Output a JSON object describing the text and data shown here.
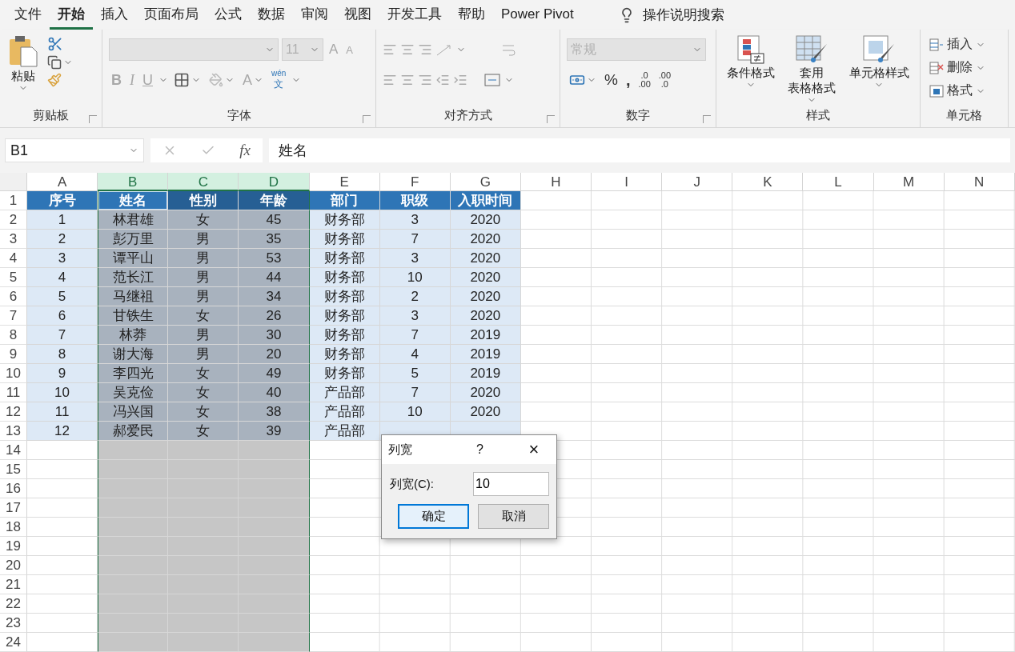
{
  "menu_tabs": [
    {
      "label": "文件",
      "selected": false
    },
    {
      "label": "开始",
      "selected": true
    },
    {
      "label": "插入",
      "selected": false
    },
    {
      "label": "页面布局",
      "selected": false
    },
    {
      "label": "公式",
      "selected": false
    },
    {
      "label": "数据",
      "selected": false
    },
    {
      "label": "审阅",
      "selected": false
    },
    {
      "label": "视图",
      "selected": false
    },
    {
      "label": "开发工具",
      "selected": false
    },
    {
      "label": "帮助",
      "selected": false
    },
    {
      "label": "Power Pivot",
      "selected": false
    }
  ],
  "tell_me": "操作说明搜索",
  "ribbon": {
    "clipboard": {
      "paste": "粘贴",
      "title": "剪贴板"
    },
    "font": {
      "size": "11",
      "grow": "A",
      "shrink": "A",
      "bold": "B",
      "italic": "I",
      "underline": "U",
      "font_color": "A",
      "phonetic_top": "wén",
      "phonetic_bottom": "文",
      "title": "字体"
    },
    "alignment": {
      "title": "对齐方式"
    },
    "number": {
      "format": "常规",
      "percent": "%",
      "comma": ",",
      "increase_decimal": [
        ".0",
        ".00"
      ],
      "decrease_decimal": [
        ".00",
        ".0"
      ],
      "title": "数字"
    },
    "styles": {
      "buttons": [
        {
          "lines": [
            "条件格式"
          ],
          "kind": "conditional"
        },
        {
          "lines": [
            "套用",
            "表格格式"
          ],
          "kind": "table"
        },
        {
          "lines": [
            "单元格样式"
          ],
          "kind": "cellstyle"
        }
      ],
      "title": "样式"
    },
    "cells": {
      "buttons": [
        {
          "label": "插入",
          "kind": "insert"
        },
        {
          "label": "删除",
          "kind": "delete"
        },
        {
          "label": "格式",
          "kind": "format"
        }
      ],
      "title": "单元格"
    }
  },
  "formula_bar": {
    "name_box": "B1",
    "fx": "fx",
    "content": "姓名"
  },
  "sheet": {
    "columns": [
      {
        "label": "A",
        "selected": false
      },
      {
        "label": "B",
        "selected": true
      },
      {
        "label": "C",
        "selected": true
      },
      {
        "label": "D",
        "selected": true
      },
      {
        "label": "E",
        "selected": false
      },
      {
        "label": "F",
        "selected": false
      },
      {
        "label": "G",
        "selected": false
      },
      {
        "label": "H",
        "selected": false
      },
      {
        "label": "I",
        "selected": false
      },
      {
        "label": "J",
        "selected": false
      },
      {
        "label": "K",
        "selected": false
      },
      {
        "label": "L",
        "selected": false
      },
      {
        "label": "M",
        "selected": false
      },
      {
        "label": "N",
        "selected": false
      }
    ],
    "row_numbers": [
      "1",
      "2",
      "3",
      "4",
      "5",
      "6",
      "7",
      "8",
      "9",
      "10",
      "11",
      "12",
      "13",
      "14",
      "15",
      "16",
      "17",
      "18",
      "19",
      "20",
      "21",
      "22",
      "23",
      "24"
    ],
    "header": [
      {
        "text": "序号",
        "active": false
      },
      {
        "text": "姓名",
        "active": true
      },
      {
        "text": "性别",
        "active": false
      },
      {
        "text": "年龄",
        "active": false
      },
      {
        "text": "部门",
        "active": false
      },
      {
        "text": "职级",
        "active": false
      },
      {
        "text": "入职时间",
        "active": false
      }
    ],
    "rows": [
      [
        "1",
        "林君雄",
        "女",
        "45",
        "财务部",
        "3",
        "2020"
      ],
      [
        "2",
        "彭万里",
        "男",
        "35",
        "财务部",
        "7",
        "2020"
      ],
      [
        "3",
        "谭平山",
        "男",
        "53",
        "财务部",
        "3",
        "2020"
      ],
      [
        "4",
        "范长江",
        "男",
        "44",
        "财务部",
        "10",
        "2020"
      ],
      [
        "5",
        "马继祖",
        "男",
        "34",
        "财务部",
        "2",
        "2020"
      ],
      [
        "6",
        "甘铁生",
        "女",
        "26",
        "财务部",
        "3",
        "2020"
      ],
      [
        "7",
        "林莽",
        "男",
        "30",
        "财务部",
        "7",
        "2019"
      ],
      [
        "8",
        "谢大海",
        "男",
        "20",
        "财务部",
        "4",
        "2019"
      ],
      [
        "9",
        "李四光",
        "女",
        "49",
        "财务部",
        "5",
        "2019"
      ],
      [
        "10",
        "吴克俭",
        "女",
        "40",
        "产品部",
        "7",
        "2020"
      ],
      [
        "11",
        "冯兴国",
        "女",
        "38",
        "产品部",
        "10",
        "2020"
      ],
      [
        "12",
        "郝爱民",
        "女",
        "39",
        "产品部"
      ]
    ]
  },
  "dialog": {
    "title": "列宽",
    "help": "?",
    "close": "×",
    "label": "列宽(C):",
    "value": "10",
    "buttons": [
      {
        "label": "确定",
        "default": true
      },
      {
        "label": "取消",
        "default": false
      }
    ]
  }
}
